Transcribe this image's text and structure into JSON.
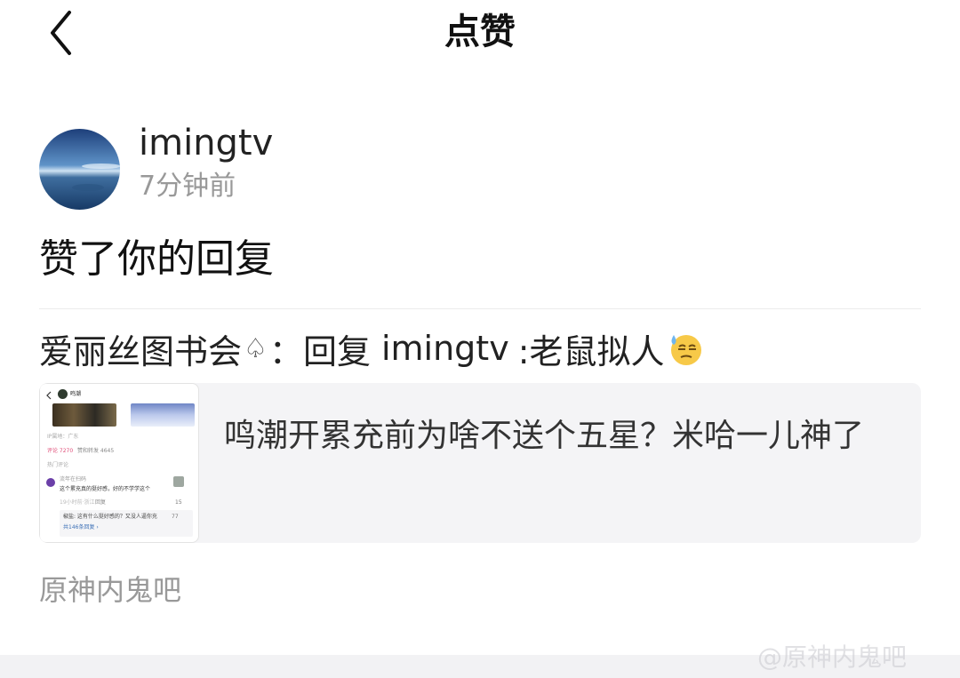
{
  "header": {
    "title": "点赞",
    "back_icon": "chevron-left-icon"
  },
  "notification": {
    "user_name": "imingtv",
    "time_ago": "7分钟前",
    "action_text": "赞了你的回复"
  },
  "reply": {
    "author": "爱丽丝图书会",
    "author_symbol": "♤",
    "separator": "：",
    "prefix": "回复",
    "mention": "imingtv",
    "content": ":老鼠拟人",
    "emoji_icon": "sweat-face-emoji-icon"
  },
  "quote": {
    "text": "鸣潮开累充前为啥不送个五星？米哈一儿神了",
    "thumbnail": {
      "title": "鸣潮",
      "meta": "IP属地：广东",
      "comments_tab": "评论 7270",
      "reposts_tab": "赞和转发 4645",
      "section": "热门评论",
      "comment_user": "流年在扫码",
      "comment_text": "这个累充真的挺好感，好的不学学这个",
      "comment_time": "19小时前·浙江",
      "reply_label": "回复",
      "likes": "15",
      "sub_reply": "椒盐: 这有什么挺好感的？又没人逼你充",
      "sub_likes": "77",
      "more_replies": "共146条回复 ›"
    }
  },
  "forum": {
    "name": "原神内鬼吧"
  },
  "watermark": "@原神内鬼吧"
}
